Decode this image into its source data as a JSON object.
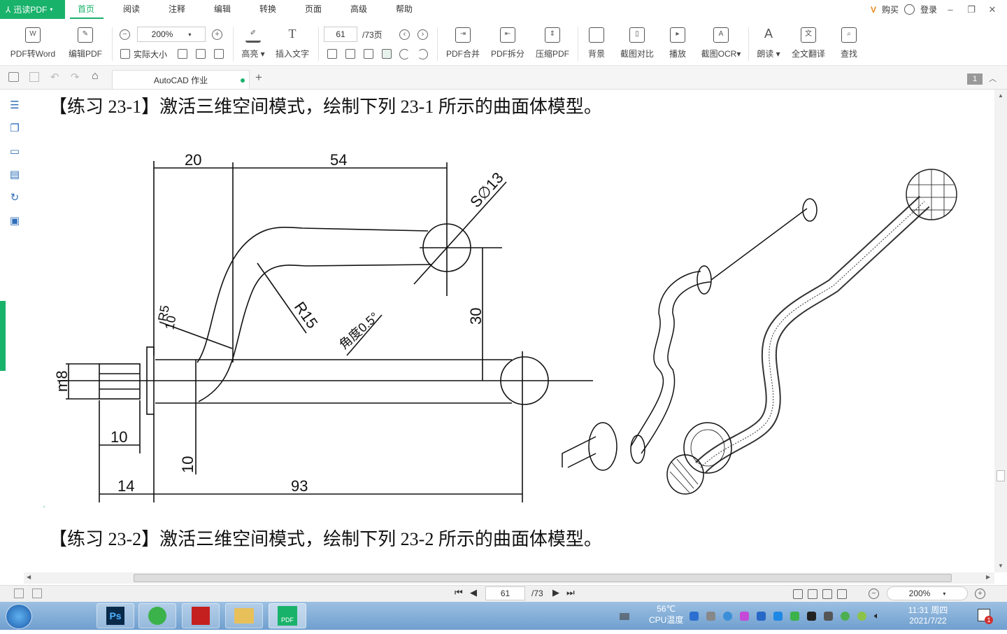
{
  "app": {
    "brand": "迅读PDF"
  },
  "menu": {
    "items": [
      "首页",
      "阅读",
      "注释",
      "编辑",
      "转换",
      "页面",
      "高级",
      "帮助"
    ]
  },
  "topright": {
    "buy": "购买",
    "login": "登录"
  },
  "ribbon": {
    "pdf_to_word": "PDF转Word",
    "edit_pdf": "编辑PDF",
    "zoom_value": "200%",
    "actual_size": "实际大小",
    "highlight": "高亮",
    "insert_text": "插入文字",
    "page_current": "61",
    "page_total": "/73页",
    "pdf_merge": "PDF合并",
    "pdf_split": "PDF拆分",
    "compress": "压缩PDF",
    "background": "背景",
    "screenshot_compare": "截图对比",
    "play": "播放",
    "screenshot_ocr": "截图OCR",
    "read_aloud": "朗读",
    "translate": "全文翻译",
    "find": "查找"
  },
  "tab": {
    "title": "AutoCAD 作业",
    "add": "+",
    "page_badge": "1"
  },
  "doc": {
    "line1": "【练习 23-1】激活三维空间模式，绘制下列 23-1 所示的曲面体模型。",
    "line2": "【练习 23-2】激活三维空间模式，绘制下列 23-2 所示的曲面体模型。"
  },
  "drawing": {
    "dims": [
      "20",
      "54",
      "S∅13",
      "R5",
      "10",
      "R15",
      "角度0.5°",
      "30",
      "m8",
      "10",
      "14",
      "93",
      "10"
    ]
  },
  "status": {
    "page_current": "61",
    "page_total": "/73",
    "zoom": "200%"
  },
  "taskbar": {
    "temp": "56℃",
    "cpu_label": "CPU温度",
    "time": "11:31 周四",
    "date": "2021/7/22",
    "notify_count": "1",
    "ps_label": "Ps",
    "pdf_label": "PDF"
  }
}
